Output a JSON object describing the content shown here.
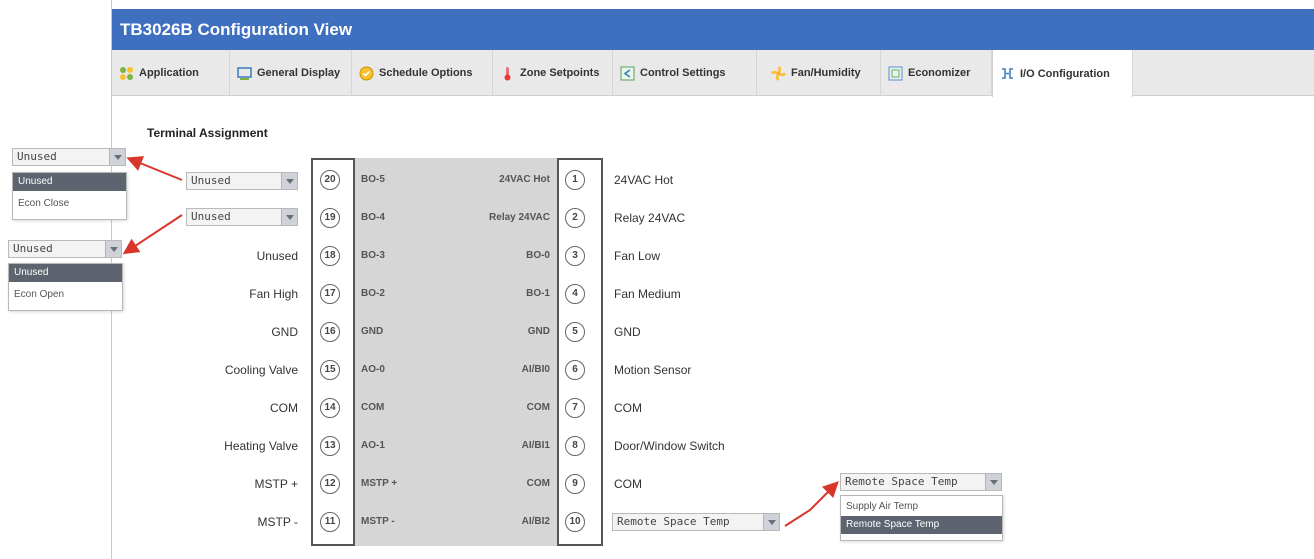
{
  "window": {
    "title": "TB3026B Configuration View"
  },
  "tabs": [
    {
      "label": "Application",
      "icon": "application-icon",
      "active": false
    },
    {
      "label": "General Display",
      "icon": "display-icon",
      "active": false
    },
    {
      "label": "Schedule Options",
      "icon": "schedule-icon",
      "active": false
    },
    {
      "label": "Zone Setpoints",
      "icon": "thermometer-icon",
      "active": false
    },
    {
      "label": "Control Settings",
      "icon": "control-icon",
      "active": false
    },
    {
      "label": "Fan/Humidity",
      "icon": "fan-icon",
      "active": false
    },
    {
      "label": "Economizer",
      "icon": "economizer-icon",
      "active": false
    },
    {
      "label": "I/O Configuration",
      "icon": "io-icon",
      "active": true
    }
  ],
  "section": {
    "title": "Terminal Assignment"
  },
  "left_terminals": [
    {
      "pin": "20",
      "signal": "BO-5",
      "label": "Unused",
      "dropdown": true
    },
    {
      "pin": "19",
      "signal": "BO-4",
      "label": "Unused",
      "dropdown": true
    },
    {
      "pin": "18",
      "signal": "BO-3",
      "label": "Unused"
    },
    {
      "pin": "17",
      "signal": "BO-2",
      "label": "Fan High"
    },
    {
      "pin": "16",
      "signal": "GND",
      "label": "GND"
    },
    {
      "pin": "15",
      "signal": "AO-0",
      "label": "Cooling Valve"
    },
    {
      "pin": "14",
      "signal": "COM",
      "label": "COM"
    },
    {
      "pin": "13",
      "signal": "AO-1",
      "label": "Heating Valve"
    },
    {
      "pin": "12",
      "signal": "MSTP +",
      "label": "MSTP +"
    },
    {
      "pin": "11",
      "signal": "MSTP -",
      "label": "MSTP -"
    }
  ],
  "right_terminals": [
    {
      "pin": "1",
      "signal": "24VAC Hot",
      "label": "24VAC Hot"
    },
    {
      "pin": "2",
      "signal": "Relay 24VAC",
      "label": "Relay 24VAC"
    },
    {
      "pin": "3",
      "signal": "BO-0",
      "label": "Fan Low"
    },
    {
      "pin": "4",
      "signal": "BO-1",
      "label": "Fan Medium"
    },
    {
      "pin": "5",
      "signal": "GND",
      "label": "GND"
    },
    {
      "pin": "6",
      "signal": "AI/BI0",
      "label": "Motion Sensor"
    },
    {
      "pin": "7",
      "signal": "COM",
      "label": "COM"
    },
    {
      "pin": "8",
      "signal": "AI/BI1",
      "label": "Door/Window Switch"
    },
    {
      "pin": "9",
      "signal": "COM",
      "label": "COM"
    },
    {
      "pin": "10",
      "signal": "AI/BI2",
      "label": "Remote Space Temp",
      "dropdown": true
    }
  ],
  "popups": {
    "bo5": {
      "selected": "Unused",
      "options": [
        "Unused",
        "Econ Close"
      ]
    },
    "bo4": {
      "selected": "Unused",
      "options": [
        "Unused",
        "Econ Open"
      ]
    },
    "ai2": {
      "selected": "Remote Space Temp",
      "options": [
        "Supply Air Temp",
        "Remote Space Temp"
      ]
    }
  },
  "colors": {
    "titlebar": "#3f6fbf",
    "arrow": "#d9352b",
    "selected_option": "#5d6470",
    "terminal_block": "#d6d6d6"
  }
}
